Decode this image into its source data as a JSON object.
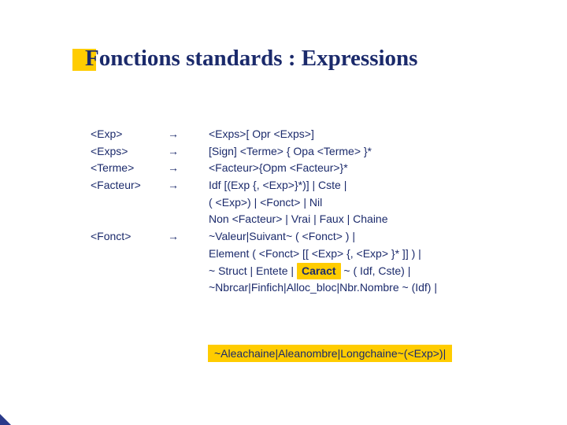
{
  "title": "Fonctions standards : Expressions",
  "arrow": "→",
  "rows": [
    {
      "lhs": "<Exp>",
      "arrow": true,
      "rhs": "<Exps>[ Opr <Exps>]"
    },
    {
      "lhs": "<Exps>",
      "arrow": true,
      "rhs": "[Sign] <Terme> { Opa <Terme> }*"
    },
    {
      "lhs": "<Terme>",
      "arrow": true,
      "rhs": "<Facteur>{Opm <Facteur>}*"
    },
    {
      "lhs": "<Facteur>",
      "arrow": true,
      "rhs": "Idf [(Exp {, <Exp>}*)] | Cste |"
    },
    {
      "lhs": "",
      "arrow": false,
      "rhs": "( <Exp>)  |  <Fonct> | Nil"
    },
    {
      "lhs": "",
      "arrow": false,
      "rhs": "Non <Facteur> | Vrai | Faux | Chaine"
    },
    {
      "lhs": "<Fonct>",
      "arrow": true,
      "rhs": "~Valeur|Suivant~  ( <Fonct> )  |"
    },
    {
      "lhs": "",
      "arrow": false,
      "rhs": "Element ( <Fonct>  [[ <Exp> {, <Exp> }* ]] ) |"
    }
  ],
  "struct_line": {
    "prefix": "~ Struct | Entete | ",
    "highlight": "Caract",
    "suffix": " ~ ( Idf, Cste) |"
  },
  "nbrcar_line": "~Nbrcar|Finfich|Alloc_bloc|Nbr.Nombre ~ (Idf) |",
  "bottom_highlight": "~Aleachaine|Aleanombre|Longchaine~(<Exp>)|"
}
